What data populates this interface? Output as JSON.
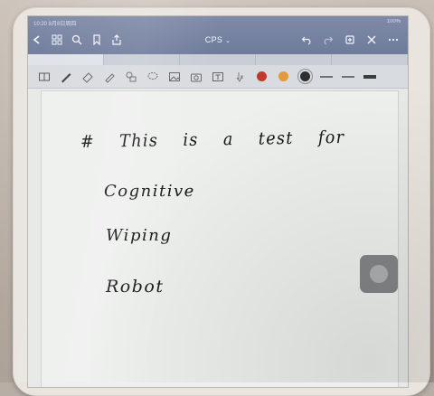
{
  "status_bar": {
    "time": "10:20 8月8日周四",
    "battery": "100%"
  },
  "nav": {
    "title": "CPS",
    "left_icons": [
      "back-icon",
      "grid-icon",
      "search-icon",
      "bookmark-icon",
      "share-icon"
    ],
    "right_icons": [
      "undo-icon",
      "redo-icon",
      "export-icon",
      "close-icon",
      "more-icon"
    ]
  },
  "toolbar": {
    "tools": [
      "read-mode-icon",
      "pen-icon",
      "eraser-icon",
      "highlighter-icon",
      "shapes-icon",
      "lasso-icon",
      "image-icon",
      "camera-icon",
      "text-icon",
      "pointer-icon"
    ],
    "colors": [
      "#c0392b",
      "#e39a3b",
      "#2c2e30"
    ],
    "strokes": [
      "thin",
      "thick"
    ]
  },
  "page": {
    "lines": [
      "# This is a test for",
      "Cognitive",
      "Wiping",
      "Robot"
    ]
  },
  "colors": {
    "nav_bar": "#7583a3",
    "toolbar": "#d8dbdf",
    "paper": "#eef0ee",
    "ink": "#141414"
  }
}
